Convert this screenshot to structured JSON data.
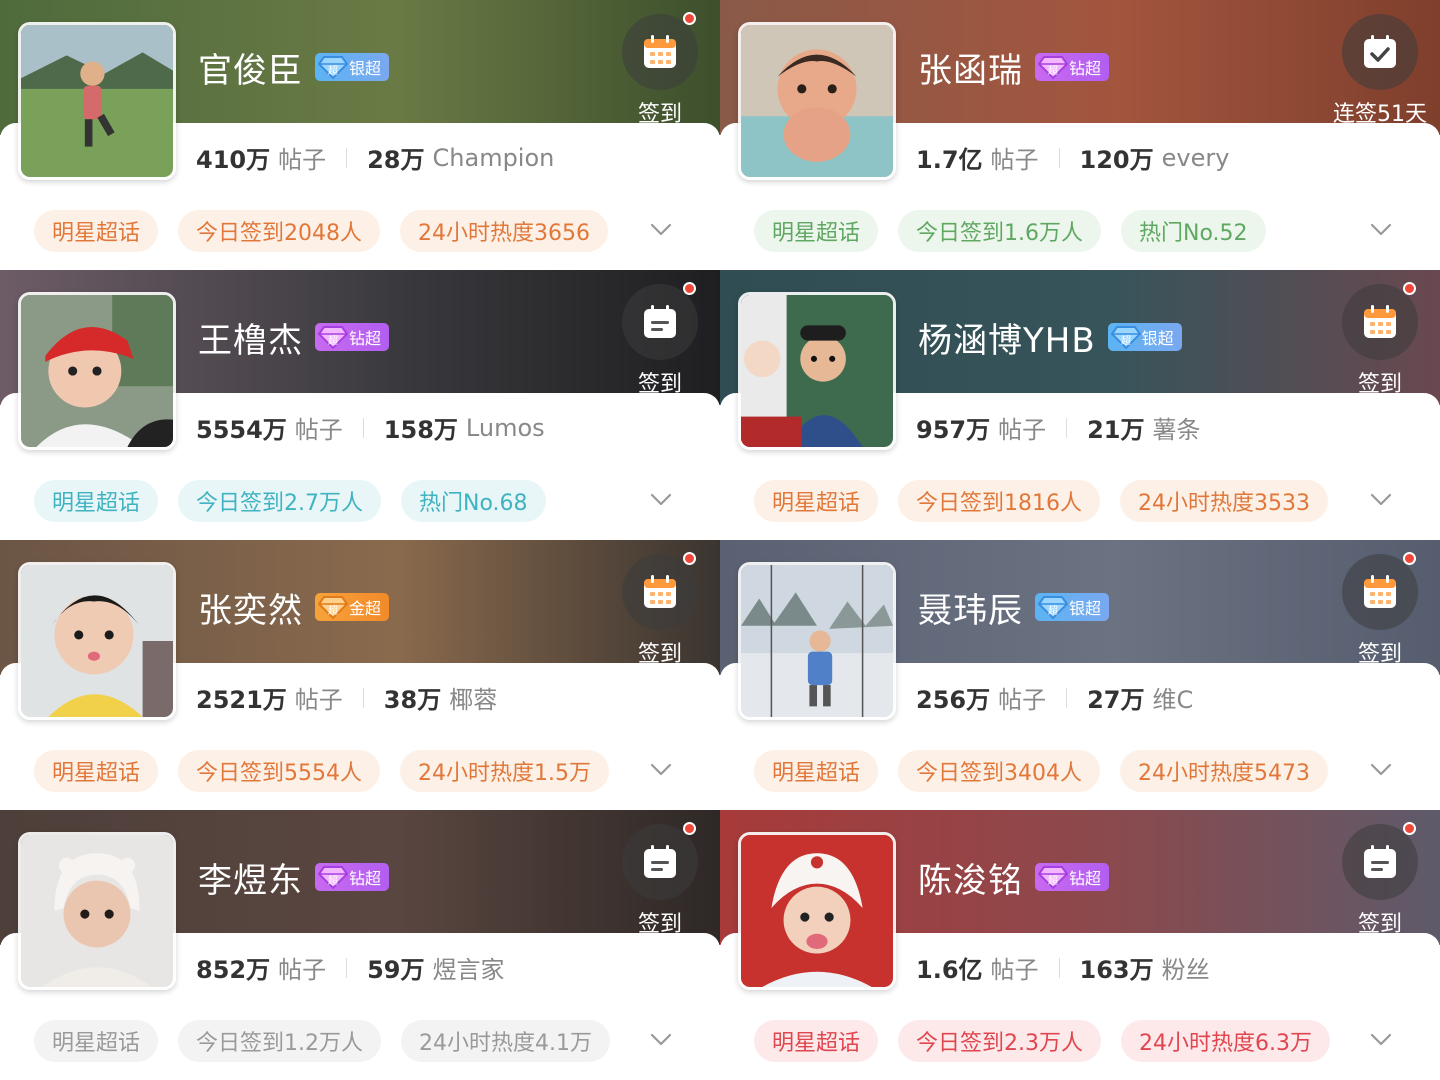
{
  "cards": [
    {
      "name": "官俊臣",
      "badge": "银超",
      "badge_type": "silver",
      "sign_label": "签到",
      "sign_icon": "calendar-grid-icon",
      "sign_dot": true,
      "posts": "410万",
      "posts_label": "帖子",
      "fans": "28万",
      "fans_label": "Champion",
      "tags": [
        "明星超话",
        "今日签到2048人",
        "24小时热度3656"
      ],
      "tag_theme": "orange",
      "banner_colors": [
        "#4f6b3c",
        "#6a7a45",
        "#3d4f2c"
      ],
      "avatar_scene": "boy-on-grass"
    },
    {
      "name": "张函瑞",
      "badge": "钻超",
      "badge_type": "diamond",
      "sign_label": "连签51天",
      "sign_icon": "calendar-check-icon",
      "sign_dot": false,
      "posts": "1.7亿",
      "posts_label": "帖子",
      "fans": "120万",
      "fans_label": "every",
      "tags": [
        "明星超话",
        "今日签到1.6万人",
        "热门No.52"
      ],
      "tag_theme": "green",
      "banner_colors": [
        "#8a5a48",
        "#a3553e",
        "#7e3f2c"
      ],
      "avatar_scene": "baby-in-bath"
    },
    {
      "name": "王橹杰",
      "badge": "钻超",
      "badge_type": "diamond",
      "sign_label": "签到",
      "sign_icon": "calendar-list-icon",
      "sign_dot": true,
      "posts": "5554万",
      "posts_label": "帖子",
      "fans": "158万",
      "fans_label": "Lumos",
      "tags": [
        "明星超话",
        "今日签到2.7万人",
        "热门No.68"
      ],
      "tag_theme": "cyan",
      "banner_colors": [
        "#6d5c66",
        "#3a3a3e",
        "#1f1f22"
      ],
      "avatar_scene": "baby-red-cap"
    },
    {
      "name": "杨涵博YHB",
      "badge": "银超",
      "badge_type": "silver",
      "sign_label": "签到",
      "sign_icon": "calendar-grid-icon",
      "sign_dot": true,
      "posts": "957万",
      "posts_label": "帖子",
      "fans": "21万",
      "fans_label": "薯条",
      "tags": [
        "明星超话",
        "今日签到1816人",
        "24小时热度3533"
      ],
      "tag_theme": "orange",
      "banner_colors": [
        "#2f4d52",
        "#37545a",
        "#6a4850"
      ],
      "avatar_scene": "boy-green-board"
    },
    {
      "name": "张奕然",
      "badge": "金超",
      "badge_type": "gold",
      "sign_label": "签到",
      "sign_icon": "calendar-grid-icon",
      "sign_dot": true,
      "posts": "2521万",
      "posts_label": "帖子",
      "fans": "38万",
      "fans_label": "椰蓉",
      "tags": [
        "明星超话",
        "今日签到5554人",
        "24小时热度1.5万"
      ],
      "tag_theme": "orange",
      "banner_colors": [
        "#6b5545",
        "#8a6a4d",
        "#3a3430"
      ],
      "avatar_scene": "baby-yellow"
    },
    {
      "name": "聂玮辰",
      "badge": "银超",
      "badge_type": "silver",
      "sign_label": "签到",
      "sign_icon": "calendar-grid-icon",
      "sign_dot": true,
      "posts": "256万",
      "posts_label": "帖子",
      "fans": "27万",
      "fans_label": "维C",
      "tags": [
        "明星超话",
        "今日签到3404人",
        "24小时热度5473"
      ],
      "tag_theme": "orange",
      "banner_colors": [
        "#5a6172",
        "#6b7282",
        "#555d6e"
      ],
      "avatar_scene": "boy-boat"
    },
    {
      "name": "李煜东",
      "badge": "钻超",
      "badge_type": "diamond",
      "sign_label": "签到",
      "sign_icon": "calendar-list-icon",
      "sign_dot": true,
      "posts": "852万",
      "posts_label": "帖子",
      "fans": "59万",
      "fans_label": "煜言家",
      "tags": [
        "明星超话",
        "今日签到1.2万人",
        "24小时热度4.1万"
      ],
      "tag_theme": "gray",
      "banner_colors": [
        "#4e3f3a",
        "#5a4640",
        "#2e2826"
      ],
      "avatar_scene": "boy-white-hat"
    },
    {
      "name": "陈浚铭",
      "badge": "钻超",
      "badge_type": "diamond",
      "sign_label": "签到",
      "sign_icon": "calendar-list-icon",
      "sign_dot": true,
      "posts": "1.6亿",
      "posts_label": "帖子",
      "fans": "163万",
      "fans_label": "粉丝",
      "tags": [
        "明星超话",
        "今日签到2.3万人",
        "24小时热度6.3万"
      ],
      "tag_theme": "red",
      "banner_colors": [
        "#a83a3a",
        "#8a4a4e",
        "#5e5a6a"
      ],
      "avatar_scene": "boy-christmas"
    }
  ]
}
